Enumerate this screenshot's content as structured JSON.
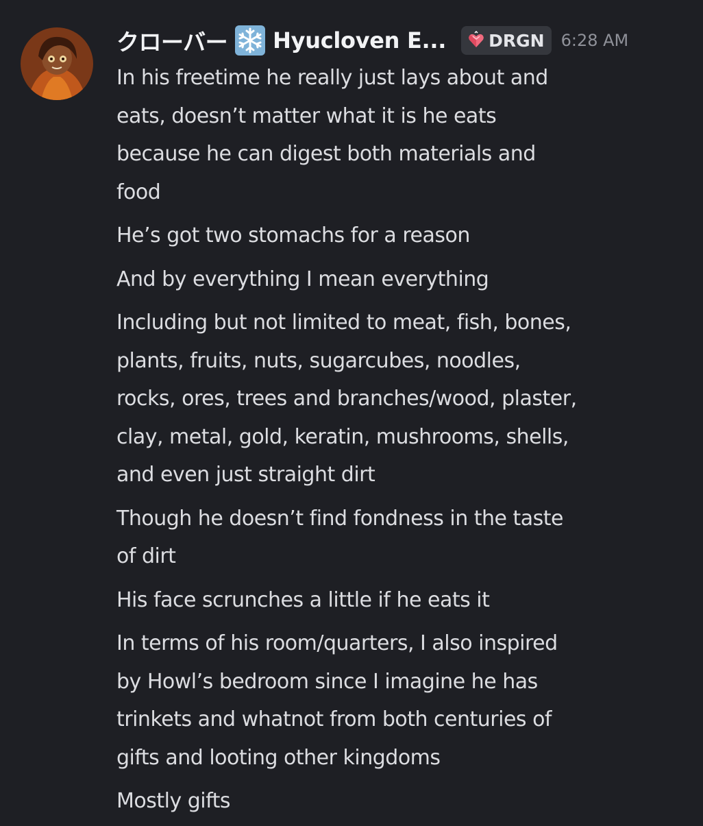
{
  "message": {
    "author_display": "クローバー",
    "author_emoji": "snowflake-emoji",
    "author_name": "Hyucloven E...",
    "tag": {
      "icon": "crystal-heart-icon",
      "label": "DRGN"
    },
    "timestamp": "6:28 AM",
    "lines": [
      [
        "In his freetime he really just lays about and",
        "eats, doesn’t matter what it is he eats",
        "because he can digest both materials and",
        "food"
      ],
      [
        "He’s got two stomachs for a reason"
      ],
      [
        "And by everything I mean everything"
      ],
      [
        "Including but not limited to meat, fish, bones,",
        "plants, fruits, nuts, sugarcubes, noodles,",
        "rocks, ores, trees and branches/wood, plaster,",
        "clay, metal, gold, keratin, mushrooms, shells,",
        "and even just straight dirt"
      ],
      [
        "Though he doesn’t find fondness in the taste",
        "of dirt"
      ],
      [
        "His face scrunches a little if he eats it"
      ],
      [
        "In terms of his room/quarters, I also inspired",
        "by Howl’s bedroom since I imagine he has",
        "trinkets and whatnot from both centuries of",
        "gifts and looting other kingdoms"
      ],
      [
        "Mostly gifts"
      ]
    ]
  },
  "colors": {
    "background": "#1e1f24",
    "text": "#dcdde1",
    "username": "#f2f3f5",
    "timestamp": "#8f9199",
    "tag_bg": "#35373d"
  }
}
